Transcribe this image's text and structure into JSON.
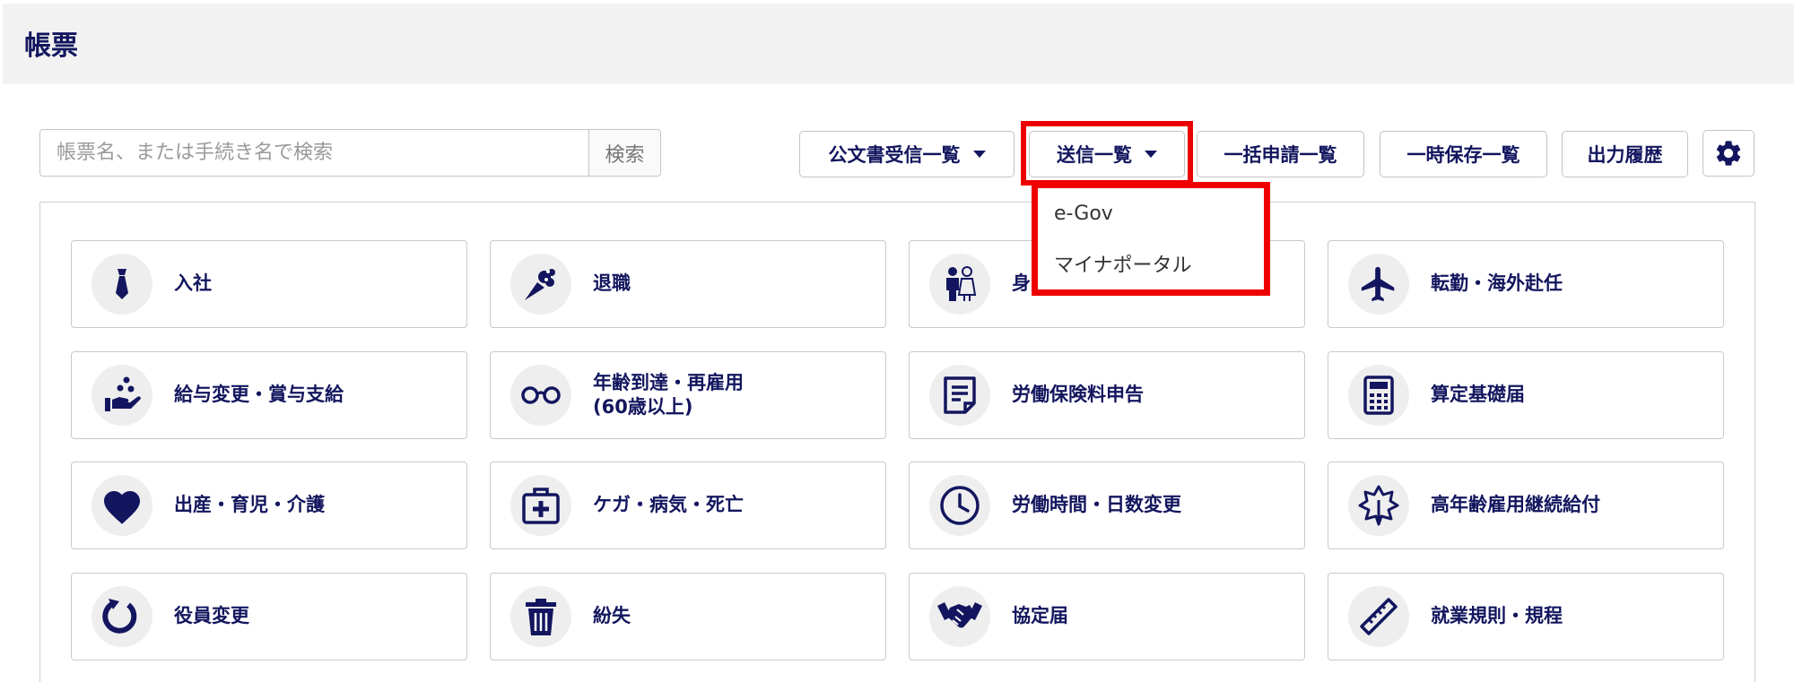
{
  "header": {
    "title": "帳票"
  },
  "search": {
    "placeholder": "帳票名、または手続き名で検索",
    "button_label": "検索"
  },
  "toolbar": {
    "received_label": "公文書受信一覧",
    "sent_label": "送信一覧",
    "bulk_label": "一括申請一覧",
    "saved_label": "一時保存一覧",
    "history_label": "出力履歴"
  },
  "dropdown": {
    "items": [
      "e-Gov",
      "マイナポータル"
    ]
  },
  "categories": [
    {
      "label": "入社",
      "icon": "necktie-icon"
    },
    {
      "label": "退職",
      "icon": "bouquet-icon"
    },
    {
      "label": "身",
      "icon": "couple-icon"
    },
    {
      "label": "転勤・海外赴任",
      "icon": "airplane-icon"
    },
    {
      "label": "給与変更・賞与支給",
      "icon": "hand-coins-icon"
    },
    {
      "label": "年齢到達・再雇用",
      "label2": "(60歳以上)",
      "icon": "glasses-icon"
    },
    {
      "label": "労働保険料申告",
      "icon": "document-icon"
    },
    {
      "label": "算定基礎届",
      "icon": "calculator-icon"
    },
    {
      "label": "出産・育児・介護",
      "icon": "heart-icon"
    },
    {
      "label": "ケガ・病気・死亡",
      "icon": "first-aid-kit-icon"
    },
    {
      "label": "労働時間・日数変更",
      "icon": "clock-icon"
    },
    {
      "label": "高年齢雇用継続給付",
      "icon": "leaf-icon"
    },
    {
      "label": "役員変更",
      "icon": "refresh-icon"
    },
    {
      "label": "紛失",
      "icon": "trash-icon"
    },
    {
      "label": "協定届",
      "icon": "handshake-icon"
    },
    {
      "label": "就業規則・規程",
      "icon": "ruler-icon"
    }
  ],
  "colors": {
    "primary": "#13165e",
    "highlight": "#ee0000",
    "header_bg": "#f2f2f2"
  }
}
